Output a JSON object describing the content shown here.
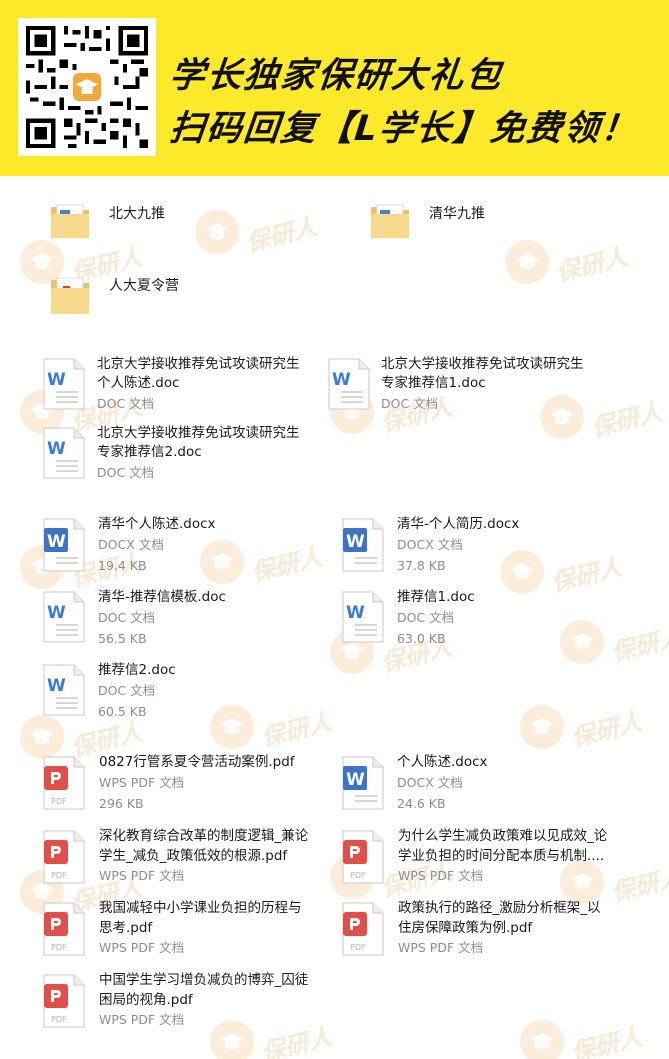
{
  "banner": {
    "line1": "学长独家保研大礼包",
    "line2": "扫码回复【L学长】免费领！",
    "accent_color": "#ffe92a"
  },
  "watermark": {
    "text": "保研人",
    "icon": "graduation-cap-icon"
  },
  "folders": [
    {
      "name": "北大九推",
      "icon": "folder-icon"
    },
    {
      "name": "清华九推",
      "icon": "folder-icon"
    },
    {
      "name": "人大夏令营",
      "icon": "folder-icon"
    }
  ],
  "files": [
    {
      "name_line1": "北京大学接收推荐免试攻读研究生",
      "name_line2": "个人陈述.doc",
      "type": "DOC 文档",
      "size": "",
      "icon": "word-doc-icon"
    },
    {
      "name_line1": "北京大学接收推荐免试攻读研究生",
      "name_line2": "专家推荐信1.doc",
      "type": "DOC 文档",
      "size": "",
      "icon": "word-doc-icon"
    },
    {
      "name_line1": "北京大学接收推荐免试攻读研究生",
      "name_line2": "专家推荐信2.doc",
      "type": "DOC 文档",
      "size": "",
      "icon": "word-doc-icon"
    },
    {
      "name_line1": "清华个人陈述.docx",
      "name_line2": "",
      "type": "DOCX 文档",
      "size": "19.4 KB",
      "icon": "word-docx-icon"
    },
    {
      "name_line1": "清华-个人简历.docx",
      "name_line2": "",
      "type": "DOCX 文档",
      "size": "37.8 KB",
      "icon": "word-docx-icon"
    },
    {
      "name_line1": "清华-推荐信模板.doc",
      "name_line2": "",
      "type": "DOC 文档",
      "size": "56.5 KB",
      "icon": "word-doc-icon"
    },
    {
      "name_line1": "推荐信1.doc",
      "name_line2": "",
      "type": "DOC 文档",
      "size": "63.0 KB",
      "icon": "word-doc-icon"
    },
    {
      "name_line1": "推荐信2.doc",
      "name_line2": "",
      "type": "DOC 文档",
      "size": "60.5 KB",
      "icon": "word-doc-icon"
    },
    {
      "name_line1": "0827行管系夏令营活动案例.pdf",
      "name_line2": "",
      "type": "WPS PDF 文档",
      "size": "296 KB",
      "icon": "pdf-icon"
    },
    {
      "name_line1": "个人陈述.docx",
      "name_line2": "",
      "type": "DOCX 文档",
      "size": "24.6 KB",
      "icon": "word-docx-icon"
    },
    {
      "name_line1": "深化教育综合改革的制度逻辑_兼论",
      "name_line2": "学生_减负_政策低效的根源.pdf",
      "type": "WPS PDF 文档",
      "size": "",
      "icon": "pdf-icon"
    },
    {
      "name_line1": "为什么学生减负政策难以见成效_论",
      "name_line2": "学业负担的时间分配本质与机制....",
      "type": "WPS PDF 文档",
      "size": "",
      "icon": "pdf-icon"
    },
    {
      "name_line1": "我国减轻中小学课业负担的历程与",
      "name_line2": "思考.pdf",
      "type": "WPS PDF 文档",
      "size": "",
      "icon": "pdf-icon"
    },
    {
      "name_line1": "政策执行的路径_激励分析框架_以",
      "name_line2": "住房保障政策为例.pdf",
      "type": "WPS PDF 文档",
      "size": "",
      "icon": "pdf-icon"
    },
    {
      "name_line1": "中国学生学习增负减负的博弈_囚徒",
      "name_line2": "困局的视角.pdf",
      "type": "WPS PDF 文档",
      "size": "",
      "icon": "pdf-icon"
    }
  ]
}
